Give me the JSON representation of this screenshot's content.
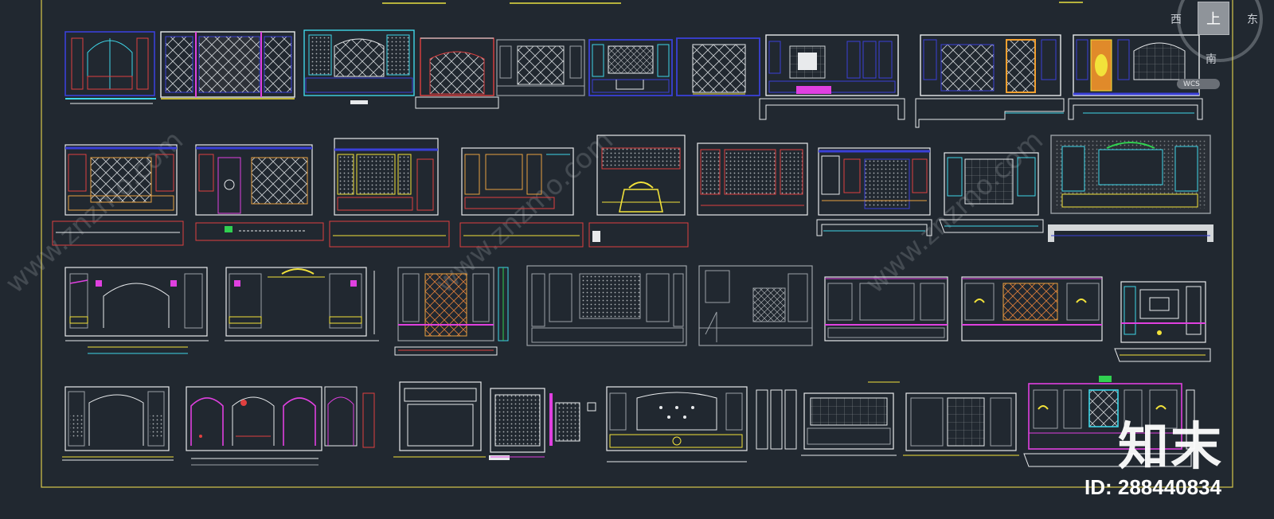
{
  "viewcube": {
    "top_face": "上",
    "west": "西",
    "east": "东",
    "south": "南",
    "wcs_label": "WCS"
  },
  "watermark": {
    "logo": "知末",
    "id_text": "ID: 288440834",
    "site_text": "www.znzmo.com"
  },
  "colors": {
    "background": "#212830",
    "frame": "#d8c84a",
    "cyan": "#3fd6e8",
    "magenta": "#e040e0",
    "yellow": "#f2e23a",
    "red": "#e04040",
    "blue": "#3a40d8",
    "white": "#e8eaec",
    "green": "#30d050",
    "gray": "#9aa0a6"
  },
  "rows": [
    {
      "panels": [
        "elevation-1",
        "elevation-2",
        "elevation-3",
        "elevation-4",
        "elevation-5",
        "elevation-6",
        "elevation-7",
        "elevation-8",
        "elevation-9",
        "elevation-10"
      ]
    },
    {
      "panels": [
        "elevation-11",
        "elevation-12",
        "elevation-13",
        "elevation-14",
        "elevation-15",
        "elevation-16",
        "elevation-17",
        "elevation-18",
        "elevation-19"
      ]
    },
    {
      "panels": [
        "elevation-20",
        "elevation-21",
        "elevation-22",
        "elevation-23",
        "elevation-24",
        "elevation-25",
        "elevation-26",
        "elevation-27"
      ]
    },
    {
      "panels": [
        "elevation-28",
        "elevation-29",
        "elevation-30",
        "elevation-31",
        "elevation-32",
        "elevation-33",
        "elevation-34",
        "elevation-35",
        "elevation-36"
      ]
    }
  ]
}
